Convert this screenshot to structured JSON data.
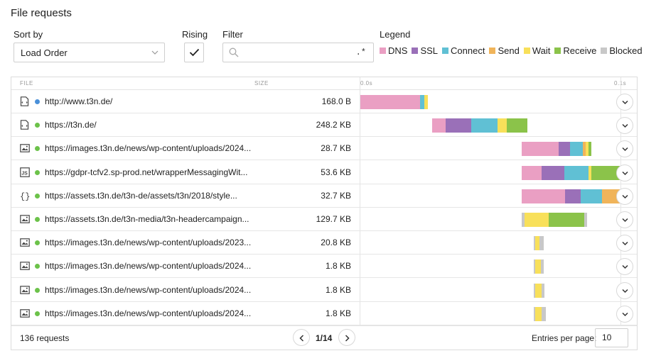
{
  "title": "File requests",
  "controls": {
    "sort_label": "Sort by",
    "sort_value": "Load Order",
    "rising_label": "Rising",
    "filter_label": "Filter",
    "filter_value": "",
    "filter_regex": ".*",
    "legend_label": "Legend"
  },
  "legend": [
    {
      "label": "DNS",
      "color": "#ea9fc3"
    },
    {
      "label": "SSL",
      "color": "#9a70b8"
    },
    {
      "label": "Connect",
      "color": "#60c0d4"
    },
    {
      "label": "Send",
      "color": "#f0b45a"
    },
    {
      "label": "Wait",
      "color": "#f8e05a"
    },
    {
      "label": "Receive",
      "color": "#8bc34a"
    },
    {
      "label": "Blocked",
      "color": "#c8c8c8"
    }
  ],
  "table": {
    "col_file": "FILE",
    "col_size": "SIZE",
    "axis_start": "0.0s",
    "axis_end": "0.1s"
  },
  "rows": [
    {
      "icon": "html-file-icon",
      "status": "#4a90d9",
      "url": "http://www.t3n.de/",
      "size": "168.0 B",
      "segments": [
        [
          "DNS",
          0.0,
          0.023
        ],
        [
          "Connect",
          0.023,
          0.0245
        ],
        [
          "Wait",
          0.0245,
          0.026
        ]
      ]
    },
    {
      "icon": "html-file-icon",
      "status": "#6cc24a",
      "url": "https://t3n.de/",
      "size": "248.2 KB",
      "segments": [
        [
          "DNS",
          0.0275,
          0.0328
        ],
        [
          "SSL",
          0.0328,
          0.0425
        ],
        [
          "Connect",
          0.0425,
          0.0527
        ],
        [
          "Wait",
          0.0527,
          0.0562
        ],
        [
          "Receive",
          0.0562,
          0.0642
        ]
      ]
    },
    {
      "icon": "image-file-icon",
      "status": "#6cc24a",
      "url": "https://images.t3n.de/news/wp-content/uploads/2024...",
      "size": "28.7 KB",
      "segments": [
        [
          "DNS",
          0.062,
          0.0763
        ],
        [
          "SSL",
          0.0763,
          0.0807
        ],
        [
          "Connect",
          0.0807,
          0.0855
        ],
        [
          "Send",
          0.0855,
          0.0865
        ],
        [
          "Wait",
          0.0865,
          0.0878
        ],
        [
          "Receive",
          0.0878,
          0.0888
        ]
      ]
    },
    {
      "icon": "js-file-icon",
      "status": "#6cc24a",
      "url": "https://gdpr-tcfv2.sp-prod.net/wrapperMessagingWit...",
      "size": "53.6 KB",
      "segments": [
        [
          "DNS",
          0.062,
          0.0697
        ],
        [
          "SSL",
          0.0697,
          0.0785
        ],
        [
          "Connect",
          0.0785,
          0.0878
        ],
        [
          "Wait",
          0.0878,
          0.0888
        ],
        [
          "Receive",
          0.0888,
          0.103
        ]
      ]
    },
    {
      "icon": "css-file-icon",
      "status": "#6cc24a",
      "url": "https://assets.t3n.de/t3n-de/assets/t3n/2018/style...",
      "size": "32.7 KB",
      "segments": [
        [
          "DNS",
          0.062,
          0.0788
        ],
        [
          "SSL",
          0.0788,
          0.0847
        ],
        [
          "Connect",
          0.0847,
          0.0928
        ],
        [
          "Send",
          0.0928,
          0.1
        ],
        [
          "Receive",
          0.1,
          0.103
        ]
      ]
    },
    {
      "icon": "image-file-icon",
      "status": "#6cc24a",
      "url": "https://assets.t3n.de/t3n-media/t3n-headercampaign...",
      "size": "129.7 KB",
      "segments": [
        [
          "Blocked",
          0.062,
          0.063
        ],
        [
          "Wait",
          0.063,
          0.0725
        ],
        [
          "Receive",
          0.0725,
          0.0862
        ],
        [
          "Blocked",
          0.0862,
          0.0872
        ]
      ]
    },
    {
      "icon": "image-file-icon",
      "status": "#6cc24a",
      "url": "https://images.t3n.de/news/wp-content/uploads/2023...",
      "size": "20.8 KB",
      "segments": [
        [
          "Blocked",
          0.0668,
          0.0672
        ],
        [
          "Wait",
          0.0672,
          0.0688
        ],
        [
          "Blocked",
          0.0688,
          0.0705
        ]
      ]
    },
    {
      "icon": "image-file-icon",
      "status": "#6cc24a",
      "url": "https://images.t3n.de/news/wp-content/uploads/2024...",
      "size": "1.8 KB",
      "segments": [
        [
          "Blocked",
          0.0668,
          0.0672
        ],
        [
          "Wait",
          0.0672,
          0.0695
        ],
        [
          "Blocked",
          0.0695,
          0.0705
        ]
      ]
    },
    {
      "icon": "image-file-icon",
      "status": "#6cc24a",
      "url": "https://images.t3n.de/news/wp-content/uploads/2024...",
      "size": "1.8 KB",
      "segments": [
        [
          "Blocked",
          0.0668,
          0.0672
        ],
        [
          "Wait",
          0.0672,
          0.0697
        ],
        [
          "Blocked",
          0.0697,
          0.0708
        ]
      ]
    },
    {
      "icon": "image-file-icon",
      "status": "#6cc24a",
      "url": "https://images.t3n.de/news/wp-content/uploads/2024...",
      "size": "1.8 KB",
      "segments": [
        [
          "Blocked",
          0.0668,
          0.0672
        ],
        [
          "Wait",
          0.0672,
          0.0698
        ],
        [
          "Blocked",
          0.0698,
          0.0712
        ]
      ]
    }
  ],
  "footer": {
    "requests": "136 requests",
    "page": "1/14",
    "entries_label": "Entries per page:",
    "entries_value": "10"
  }
}
